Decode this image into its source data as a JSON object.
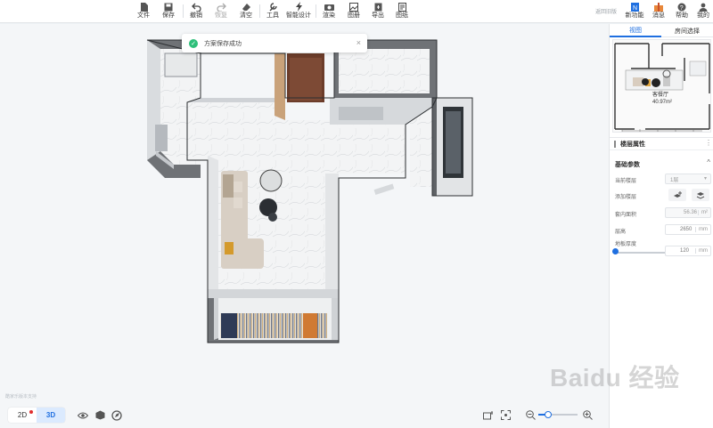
{
  "toolbar": {
    "items": [
      {
        "label": "文件",
        "icon": "file-icon"
      },
      {
        "label": "保存",
        "icon": "save-icon"
      },
      {
        "label": "撤销",
        "icon": "undo-icon"
      },
      {
        "label": "恢复",
        "icon": "redo-icon",
        "disabled": true
      },
      {
        "label": "清空",
        "icon": "eraser-icon"
      },
      {
        "label": "工具",
        "icon": "wrench-icon"
      },
      {
        "label": "智能设计",
        "icon": "lightning-icon"
      },
      {
        "label": "渲染",
        "icon": "camera-icon"
      },
      {
        "label": "图册",
        "icon": "album-icon"
      },
      {
        "label": "导出",
        "icon": "export-icon"
      },
      {
        "label": "图纸",
        "icon": "drawing-icon"
      }
    ],
    "feedback": "返回旧版",
    "right_items": [
      {
        "label": "新功能",
        "icon": "new-feature-icon"
      },
      {
        "label": "消息",
        "icon": "gift-icon"
      },
      {
        "label": "帮助",
        "icon": "help-icon"
      },
      {
        "label": "我的",
        "icon": "user-icon"
      }
    ]
  },
  "toast": {
    "message": "方案保存成功",
    "icon": "check-circle-icon"
  },
  "view_panel": {
    "tabs": [
      "视图",
      "房间选择"
    ],
    "active_tab": 0,
    "minimap_room_name": "客餐厅",
    "minimap_area": "40.97m²"
  },
  "properties": {
    "header": "楼层属性",
    "section": "基础参数",
    "rows": {
      "current_floor_label": "当前楼层",
      "current_floor_value": "1层",
      "add_floor_label": "添加楼层",
      "indoor_area_label": "套内面积",
      "indoor_area_value": "56.36",
      "indoor_area_unit": "m²",
      "floor_height_label": "层高",
      "floor_height_value": "2650",
      "floor_height_unit": "mm",
      "slab_thickness_label": "地板厚度",
      "slab_thickness_value": "120",
      "slab_thickness_unit": "mm"
    }
  },
  "bottom": {
    "mode_2d": "2D",
    "mode_3d": "3D",
    "active_mode": "3D",
    "hint": "酷家乐版本支持",
    "zoom_level": 0.25
  },
  "watermark": "Baidu 经验",
  "colors": {
    "accent": "#1f6fe0",
    "success": "#2ebf7a",
    "badge": "#e02e2e"
  }
}
